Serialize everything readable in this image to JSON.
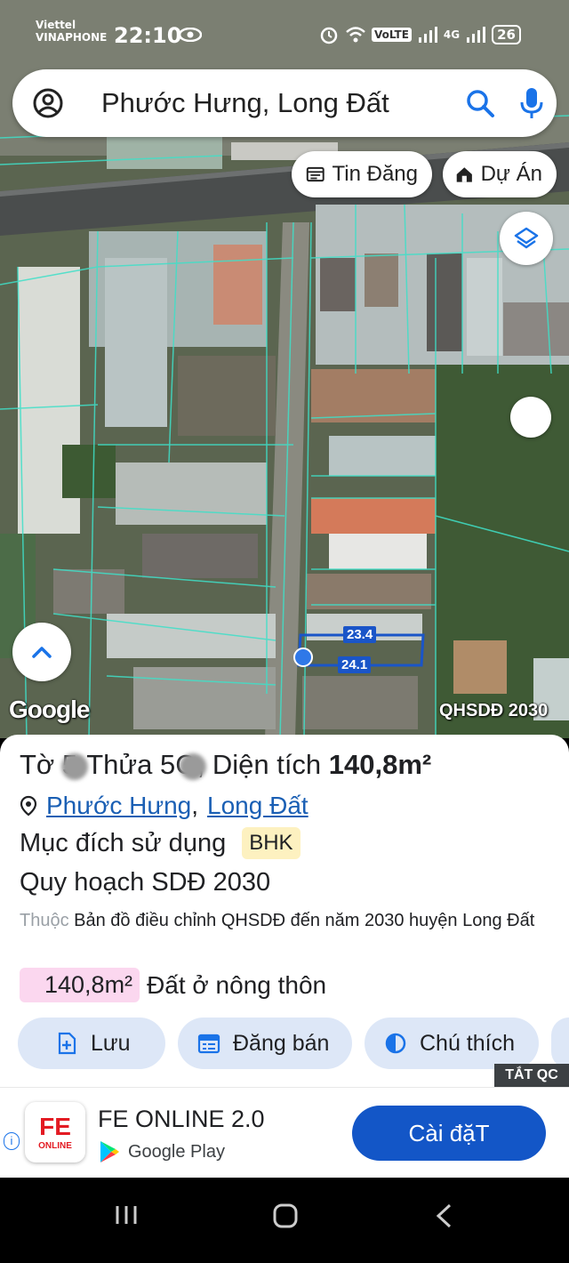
{
  "status_bar": {
    "carrier_1": "Viettel",
    "carrier_2": "VINAPHONE",
    "time": "22:10",
    "volte": "VoLTE",
    "network": "4G",
    "battery": "26"
  },
  "search": {
    "query": "Phước Hưng, Long Đất"
  },
  "chips": {
    "news": "Tin Đăng",
    "project": "Dự Án"
  },
  "map": {
    "google_logo": "Google",
    "layer_label": "QHSDĐ 2030",
    "measure_top": "23.4",
    "measure_bottom": "24.1"
  },
  "parcel": {
    "sheet_label": "Tờ 5",
    "sheet_suffix": "Thửa 5C",
    "area_label": ", Diện tích",
    "area_value": "140,8m²",
    "ward": "Phước Hưng",
    "district": "Long Đất",
    "purpose_label": "Mục đích sử dụng",
    "purpose_code": "BHK",
    "plan_title": "Quy hoạch SDĐ 2030",
    "plan_belongs": "Thuộc",
    "plan_desc": "Bản đồ điều chỉnh QHSDĐ đến năm 2030 huyện Long Đất",
    "land_area": "140,8m²",
    "land_type": "Đất ở nông thôn"
  },
  "actions": {
    "save": "Lưu",
    "sell": "Đăng bán",
    "legend": "Chú thích"
  },
  "ad": {
    "close_label": "TẮT QC",
    "logo_text": "FE",
    "logo_sub": "ONLINE",
    "title": "FE ONLINE 2.0",
    "store": "Google Play",
    "install": "Cài đặT"
  },
  "colors": {
    "accent_blue": "#1356c7",
    "link_blue": "#1a5fb4",
    "badge_yellow": "#fdf1c0",
    "area_pink": "#fbd7ef",
    "button_bg": "#dde7f7"
  }
}
